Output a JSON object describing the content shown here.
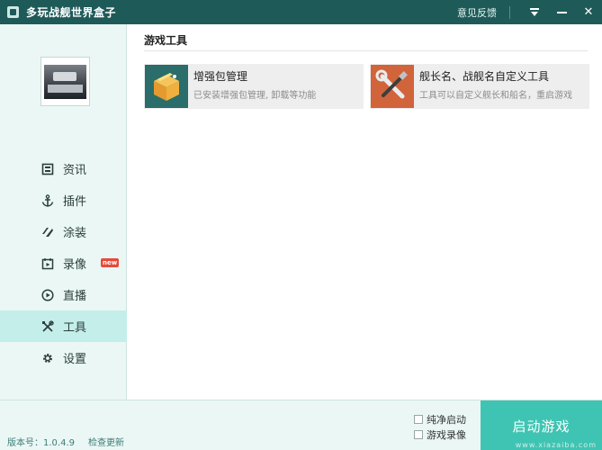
{
  "titlebar": {
    "app_icon": "game-box-icon",
    "title": "多玩战舰世界盒子",
    "feedback_label": "意见反馈",
    "menu_icon": "dropdown-menu-icon",
    "minimize_icon": "minimize-icon",
    "close_icon": "close-icon",
    "close_glyph": "✕"
  },
  "sidebar": {
    "items": [
      {
        "label": "资讯",
        "icon": "news-icon"
      },
      {
        "label": "插件",
        "icon": "anchor-icon"
      },
      {
        "label": "涂装",
        "icon": "paint-stripes-icon"
      },
      {
        "label": "录像",
        "icon": "record-icon",
        "badge": "new"
      },
      {
        "label": "直播",
        "icon": "play-circle-icon"
      },
      {
        "label": "工具",
        "icon": "tools-icon",
        "active": true
      },
      {
        "label": "设置",
        "icon": "gear-icon"
      }
    ]
  },
  "main": {
    "section_title": "游戏工具",
    "tools": [
      {
        "name": "增强包管理",
        "desc": "已安装增强包管理, 卸载等功能",
        "icon": "package-box-icon"
      },
      {
        "name": "舰长名、战舰名自定义工具",
        "desc": "工具可以自定义舰长和船名，重启游戏",
        "icon": "wrench-screwdriver-icon"
      }
    ]
  },
  "bottom": {
    "version": "版本号：1.0.4.9",
    "check_update": "检查更新",
    "option_pure_launch": "纯净启动",
    "option_record": "游戏录像",
    "launch_button": "启动游戏",
    "watermark": "www.xiazaiba.com"
  },
  "colors": {
    "titlebar": "#1e5a58",
    "sidebar_bg": "#eaf7f5",
    "active_item": "#c4eeea",
    "launch_button": "#3fc4b3",
    "new_badge": "#e54b3c"
  }
}
